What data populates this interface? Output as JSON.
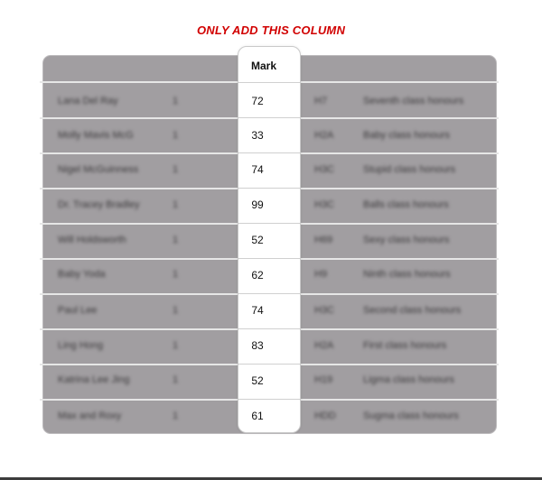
{
  "instruction": "ONLY ADD THIS COLUMN",
  "table": {
    "header": {
      "mark": "Mark"
    },
    "rows": [
      {
        "name": "Lana Del Ray",
        "n": "1",
        "mark": "72",
        "code": "H7",
        "class": "Seventh class honours"
      },
      {
        "name": "Molly Mavis McG",
        "n": "1",
        "mark": "33",
        "code": "H2A",
        "class": "Baby class honours"
      },
      {
        "name": "Nigel McGuinness",
        "n": "1",
        "mark": "74",
        "code": "H3C",
        "class": "Stupid class honours"
      },
      {
        "name": "Dr. Tracey Bradley",
        "n": "1",
        "mark": "99",
        "code": "H3C",
        "class": "Balls class honours"
      },
      {
        "name": "Will Holdsworth",
        "n": "1",
        "mark": "52",
        "code": "H69",
        "class": "Sexy class honours"
      },
      {
        "name": "Baby Yoda",
        "n": "1",
        "mark": "62",
        "code": "H9",
        "class": "Ninth class honours"
      },
      {
        "name": "Paul Lee",
        "n": "1",
        "mark": "74",
        "code": "H3C",
        "class": "Second class honours"
      },
      {
        "name": "Ling Hong",
        "n": "1",
        "mark": "83",
        "code": "H2A",
        "class": "First class honours"
      },
      {
        "name": "Katrina Lee Jing",
        "n": "1",
        "mark": "52",
        "code": "H19",
        "class": "Ligma class honours"
      },
      {
        "name": "Max and Roxy",
        "n": "1",
        "mark": "61",
        "code": "HDD",
        "class": "Sugma class honours"
      }
    ]
  }
}
